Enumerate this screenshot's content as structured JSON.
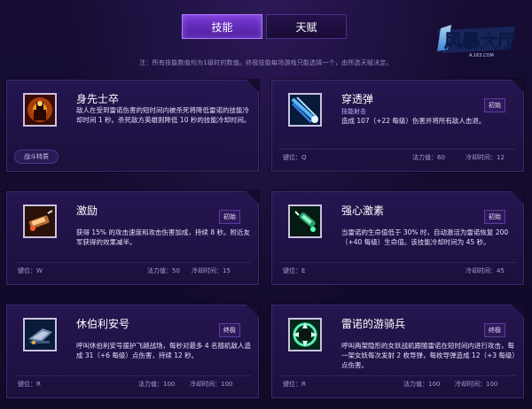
{
  "tabs": [
    {
      "label": "技能",
      "active": true
    },
    {
      "label": "天赋",
      "active": false
    }
  ],
  "logo": {
    "text": "风暴大厅",
    "subtext": "A.163.COM"
  },
  "note": "注：所有技能数值均为1级时的数值。终极技能每场游戏只能选择一个，由所选天赋决定。",
  "cards": [
    {
      "name": "身先士卒",
      "subtitle": "",
      "badge": "",
      "description": "敌人在受到雷诺伤害的短时间内被杀死将降低雷诺的技能冷却时间 1 秒。杀死敌方英雄则降低 10 秒的技能冷却时间。",
      "trait_label": "战斗特质",
      "key_label": "",
      "mana_label": "",
      "cooldown_label": ""
    },
    {
      "name": "穿透弹",
      "subtitle": "技能射击",
      "badge": "初始",
      "description": "造成 107（+22 每级）伤害并将所有敌人击退。",
      "trait_label": "",
      "key_label": "键位：Q",
      "mana_label": "法力值：60",
      "cooldown_label": "冷却时间：12"
    },
    {
      "name": "激励",
      "subtitle": "",
      "badge": "初始",
      "description": "获得 15% 的攻击速度和攻击伤害加成，持续 8 秒。附近友军获得的效果减半。",
      "trait_label": "",
      "key_label": "键位：W",
      "mana_label": "法力值：50",
      "cooldown_label": "冷却时间：15"
    },
    {
      "name": "强心激素",
      "subtitle": "",
      "badge": "初始",
      "description": "当雷诺的生命值低于 30% 时，自动激活为雷诺恢复 200（+40 每级）生命值。该技能冷却时间为 45 秒。",
      "trait_label": "",
      "key_label": "键位：E",
      "mana_label": "",
      "cooldown_label": "冷却时间：45"
    },
    {
      "name": "休伯利安号",
      "subtitle": "",
      "badge": "终极",
      "description": "呼叫休伯利安号援护飞越战场，每秒对最多 4 名随机敌人造成 31（+6 每级）点伤害，持续 12 秒。",
      "trait_label": "",
      "key_label": "键位：R",
      "mana_label": "法力值：100",
      "cooldown_label": "冷却时间：100"
    },
    {
      "name": "雷诺的游骑兵",
      "subtitle": "",
      "badge": "终极",
      "description": "呼叫两架隐形的女妖战机跟随雷诺在短时间内进行攻击，每一架女妖每次发射 2 枚导弹，每枚导弹造成 12（+3 每级）点伤害。",
      "trait_label": "",
      "key_label": "键位：R",
      "mana_label": "法力值：100",
      "cooldown_label": "冷却时间：100"
    }
  ]
}
